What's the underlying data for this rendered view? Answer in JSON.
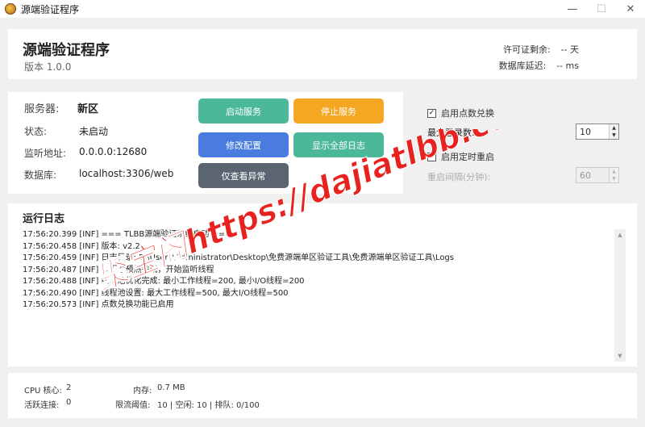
{
  "window": {
    "title": "源端验证程序",
    "minimize": "—",
    "maximize": "☐",
    "close": "✕"
  },
  "header": {
    "app_name": "源端验证程序",
    "version": "版本 1.0.0",
    "license_label": "许可证剩余:",
    "license_value": "-- 天",
    "db_latency_label": "数据库延迟:",
    "db_latency_value": "-- ms"
  },
  "info": {
    "server_label": "服务器:",
    "server_value": "新区",
    "status_label": "状态:",
    "status_value": "未启动",
    "listen_label": "监听地址:",
    "listen_value": "0.0.0.0:12680",
    "db_label": "数据库:",
    "db_value": "localhost:3306/web"
  },
  "buttons": {
    "start": "启动服务",
    "stop": "停止服务",
    "config": "修改配置",
    "show": "显示全部日志",
    "errors_only": "仅查看异常"
  },
  "options": {
    "points_label": "启用点数兑换",
    "points_checked": true,
    "max_login_label": "最大登录数:",
    "max_login_value": "10",
    "timed_restart_label": "启用定时重启",
    "timed_restart_checked": false,
    "restart_interval_label": "重启间隔(分钟):",
    "restart_interval_value": "60"
  },
  "log": {
    "title": "运行日志",
    "lines": [
      "17:56:20.399 [INF] === TLBB源端验证系统启动 ===",
      "17:56:20.458 [INF] 版本: v2.2",
      "17:56:20.459 [INF] 日志目录: B:\\Users\\Administrator\\Desktop\\免费源端单区验证工具\\免费源端单区验证工具\\Logs",
      "17:56:20.487 [INF] 线程池预热完成，开始监听线程",
      "17:56:20.488 [INF] 线程池优化完成: 最小工作线程=200, 最小I/O线程=200",
      "17:56:20.490 [INF] 线程池设置: 最大工作线程=500, 最大I/O线程=500",
      "17:56:20.573 [INF] 点数兑换功能已启用"
    ]
  },
  "status": {
    "cpu_label": "CPU 核心:",
    "cpu_value": "2",
    "mem_label": "内存:",
    "mem_value": "0.7 MB",
    "active_label": "活跃连接:",
    "active_value": "0",
    "throttle_label": "限流阈值:",
    "throttle_value": "10 | 空闲: 10 | 排队: 0/100"
  },
  "watermark": {
    "text": "聚宝阁https://dajiatlbb.com/"
  },
  "colors": {
    "green": "#4cb89a",
    "orange": "#f5a623",
    "blue": "#4a7ce0",
    "dark": "#5a6571",
    "watermark": "#e8231f"
  }
}
